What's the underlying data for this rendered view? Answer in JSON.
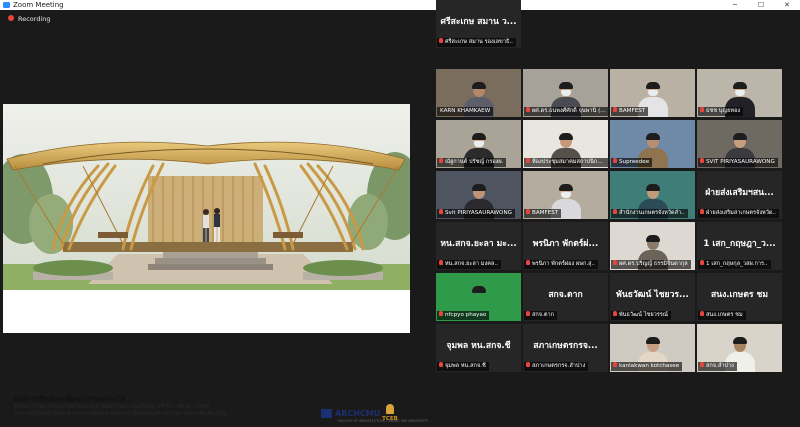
{
  "window": {
    "title": "Zoom Meeting"
  },
  "recording": {
    "label": "Recording"
  },
  "share": {
    "caption_head": "ศูนย์การเรียนรู้และพัฒนาการออกแบบไผ่",
    "caption_line1": "โครงการวิทยานิพนธ์วิทยานิพนธ์สถาปัตยกรรมระดับปริญญาตรี ปีการศึกษา 2558",
    "caption_line2": "อาจารย์ปิยชนน์ ดุนจะนำ อาจารย์ประจำคณะสถาปัตยกรรมศาสตร์ มหาวิทยาลัยเชียงใหม่",
    "logo1": "ARCHCMU",
    "logo1_sub": "FACULTY OF ARCHITECTURE CHIANG MAI UNIVERSITY",
    "logo2": "TCEB"
  },
  "participants": [
    {
      "name": "KARN KHAMKAEW",
      "big": "",
      "type": "video",
      "active": true,
      "mic": "none",
      "bg": "#7a6d5d",
      "skin": "#b5876a",
      "shirt": "#5c5e69",
      "mask": false
    },
    {
      "name": "ผศ.ดร.ธนพงศ์ศักดิ์ จุนพานิ (สกว..",
      "big": "",
      "type": "video",
      "active": false,
      "mic": "muted",
      "bg": "#a6a199",
      "skin": "#c8a084",
      "shirt": "#4a4b52",
      "mask": true
    },
    {
      "name": "BAMFEST",
      "big": "",
      "type": "video",
      "active": false,
      "mic": "muted",
      "bg": "#b8b1a4",
      "skin": "#d9b196",
      "shirt": "#e4e4e6",
      "mask": true
    },
    {
      "name": "ธชช บุญยทอง",
      "big": "",
      "type": "video",
      "active": false,
      "mic": "muted",
      "bg": "#bcb6aa",
      "skin": "#d1a988",
      "shirt": "#222226",
      "mask": true
    },
    {
      "name": "ณัฐกานต์ ปรัชญ์ กรองผ.",
      "big": "",
      "type": "video",
      "active": false,
      "mic": "muted",
      "bg": "#a9a398",
      "skin": "#d2ab8e",
      "shirt": "#2b2b2b",
      "mask": true
    },
    {
      "name": "ห้องประชุมสมาคมสถาปนิกสยาม",
      "big": "",
      "type": "video",
      "active": false,
      "mic": "muted",
      "bg": "#e9e6df",
      "skin": "#c49a7b",
      "shirt": "#55504a",
      "mask": false
    },
    {
      "name": "Supreedee",
      "big": "",
      "type": "video",
      "active": false,
      "mic": "muted",
      "bg": "#6f8aa6",
      "skin": "#b98d70",
      "shirt": "#8e7450",
      "mask": false
    },
    {
      "name": "SVIT PIRIYASAURAWONG",
      "big": "",
      "type": "video",
      "active": false,
      "mic": "muted",
      "bg": "#6e6a62",
      "skin": "#c79d7d",
      "shirt": "#3b3b3f",
      "mask": false
    },
    {
      "name": "Svit PIRIYASAURAWONG",
      "big": "",
      "type": "video",
      "active": false,
      "mic": "muted",
      "bg": "#4f5560",
      "skin": "#bf9476",
      "shirt": "#2a2a2e",
      "mask": false
    },
    {
      "name": "BAMFEST",
      "big": "",
      "type": "video",
      "active": false,
      "mic": "muted",
      "bg": "#b4ad9f",
      "skin": "#d8b094",
      "shirt": "#d9d9dc",
      "mask": true
    },
    {
      "name": "สำนักงานเกษตรจังหวัดลำ..",
      "big": "",
      "type": "video",
      "active": false,
      "mic": "muted",
      "bg": "#3f7d79",
      "skin": "#c39a7b",
      "shirt": "#2c4b59",
      "mask": false
    },
    {
      "name": "ฝ่ายส่งเสริมสาเกษตรจังหวัด..",
      "big": "ฝ่ายส่งเสริมฯสน...",
      "type": "name",
      "active": false,
      "mic": "muted"
    },
    {
      "name": "หน.สกจ.ยะลา มงคล..",
      "big": "หน.สกจ.ยะลา มะ...",
      "type": "name",
      "active": false,
      "mic": "muted"
    },
    {
      "name": "พรนิภา พักตร์ผ่อง ผษก.สุ..",
      "big": "พรนิภา พักตร์ผ่...",
      "type": "name",
      "active": false,
      "mic": "muted"
    },
    {
      "name": "ผศ.ดร.ปริญญ์ ธรรมิจินดากุล",
      "big": "",
      "type": "video",
      "active": false,
      "mic": "muted",
      "bg": "#ddd9d2",
      "skin": "#8a7a6a",
      "shirt": "#6b6259",
      "mask": false
    },
    {
      "name": "1 เสก_กฤษกุล_วสผ.การ..",
      "big": "1 เสก_กฤษฎา_ว...",
      "type": "name",
      "active": false,
      "mic": "muted"
    },
    {
      "name": "nfcpyo phayao",
      "big": "",
      "type": "video",
      "active": false,
      "mic": "muted",
      "bg": "#2f9a4a",
      "skin": "#2f9a4a",
      "shirt": "#2f9a4a",
      "mask": false
    },
    {
      "name": "สกจ.ตาก",
      "big": "สกจ.ตาก",
      "type": "name",
      "active": false,
      "mic": "muted"
    },
    {
      "name": "พันธวัฒน์ ไชยวรรณ์",
      "big": "พันธวัฒน์ ไชยวร...",
      "type": "name",
      "active": false,
      "mic": "muted"
    },
    {
      "name": "สนง.เกษตร ชม",
      "big": "สนง.เกษตร ชม",
      "type": "name",
      "active": false,
      "mic": "muted"
    },
    {
      "name": "จุมพล หน.สกจ.ชี",
      "big": "จุมพล หน.สกจ.ชี",
      "type": "name",
      "active": false,
      "mic": "muted"
    },
    {
      "name": "สภาเกษตรกรจ.ลำปาง",
      "big": "สภาเกษตรกรจ...",
      "type": "name",
      "active": false,
      "mic": "muted"
    },
    {
      "name": "kanlakwan kotchasee",
      "big": "",
      "type": "video",
      "active": false,
      "mic": "muted",
      "bg": "#cfcac2",
      "skin": "#c79e82",
      "shirt": "#e5d7c8",
      "mask": false
    },
    {
      "name": "สกจ.ลำปาง",
      "big": "",
      "type": "video",
      "active": false,
      "mic": "muted",
      "bg": "#d9d4ca",
      "skin": "#a8825f",
      "shirt": "#f0f0ea",
      "mask": false
    },
    {
      "name": "ศรีสะเกษ สมาน รองเลขาธิ..",
      "big": "ศรีสะเกษ สมาน ว...",
      "type": "name",
      "active": false,
      "mic": "muted"
    }
  ]
}
